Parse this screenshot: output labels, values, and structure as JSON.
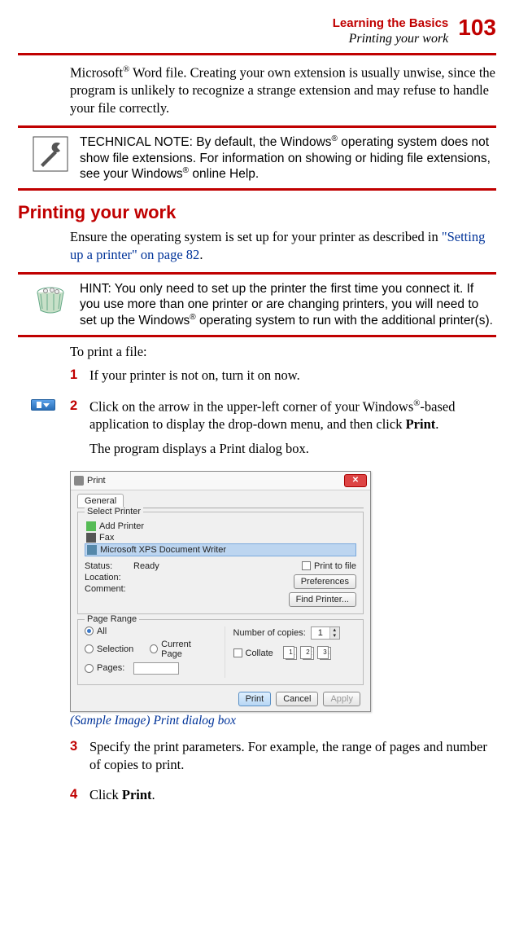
{
  "header": {
    "chapter": "Learning the Basics",
    "section": "Printing your work",
    "page": "103"
  },
  "paragraph_intro_1": "Microsoft",
  "paragraph_intro_2": " Word file. Creating your own extension is usually unwise, since the program is unlikely to recognize a strange extension and may refuse to handle your file correctly.",
  "technote": {
    "label": "TECHNICAL NOTE: ",
    "t1": "By default, the Windows",
    "t2": " operating system does not show file extensions. For information on showing or hiding file extensions, see your Windows",
    "t3": " online Help."
  },
  "heading": "Printing your work",
  "para_ensure_1": "Ensure the operating system is set up for your printer as described in ",
  "para_ensure_link": "\"Setting up a printer\" on page 82",
  "para_ensure_2": ".",
  "hint": {
    "label": "HINT: ",
    "t1": "You only need to set up the printer the first time you connect it. If you use more than one printer or are changing printers, you will need to set up the Windows",
    "t2": " operating system to run with the additional printer(s)."
  },
  "to_print": "To print a file:",
  "step1": {
    "num": "1",
    "text": "If your printer is not on, turn it on now."
  },
  "step2": {
    "num": "2",
    "t1": "Click on the arrow in the upper-left corner of your Windows",
    "t2": "-based application to display the drop-down menu, and then click ",
    "bold": "Print",
    "t3": ".",
    "after": "The program displays a Print dialog box."
  },
  "caption": "(Sample Image) Print dialog box",
  "step3": {
    "num": "3",
    "text": "Specify the print parameters. For example, the range of pages and number of copies to print."
  },
  "step4": {
    "num": "4",
    "t1": "Click ",
    "bold": "Print",
    "t2": "."
  },
  "dialog": {
    "title": "Print",
    "tab_general": "General",
    "fs_select": "Select Printer",
    "printer_add": "Add Printer",
    "printer_fax": "Fax",
    "printer_xps": "Microsoft XPS Document Writer",
    "lbl_status": "Status:",
    "val_status": "Ready",
    "lbl_location": "Location:",
    "lbl_comment": "Comment:",
    "chk_printtofile": "Print to file",
    "btn_prefs": "Preferences",
    "btn_findprinter": "Find Printer...",
    "fs_pagerange": "Page Range",
    "rb_all": "All",
    "rb_selection": "Selection",
    "rb_currentpage": "Current Page",
    "rb_pages": "Pages:",
    "lbl_copies": "Number of copies:",
    "val_copies": "1",
    "chk_collate": "Collate",
    "btn_print": "Print",
    "btn_cancel": "Cancel",
    "btn_apply": "Apply"
  }
}
